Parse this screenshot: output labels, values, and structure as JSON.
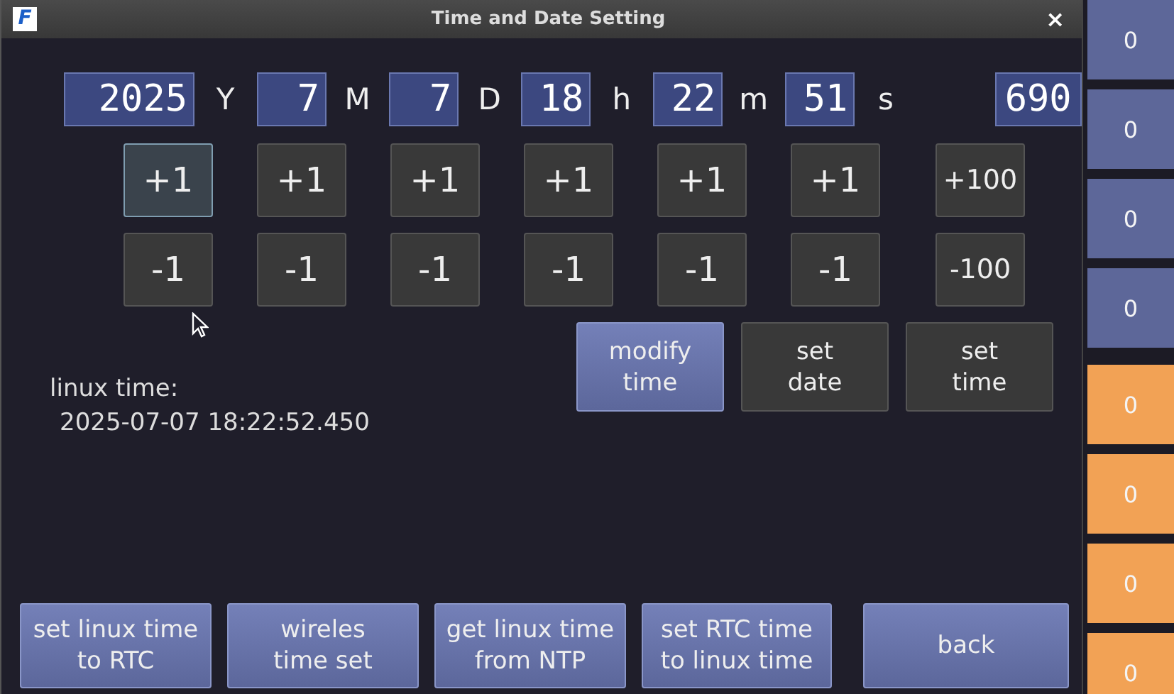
{
  "window": {
    "title": "Time and Date Setting",
    "logo_letter": "F",
    "close": "×"
  },
  "fields": [
    {
      "value": "2025",
      "unit": "Y"
    },
    {
      "value": "7",
      "unit": "M"
    },
    {
      "value": "7",
      "unit": "D"
    },
    {
      "value": "18",
      "unit": "h"
    },
    {
      "value": "22",
      "unit": "m"
    },
    {
      "value": "51",
      "unit": "s"
    },
    {
      "value": "690"
    }
  ],
  "increment_buttons": [
    {
      "label": "+1",
      "focused": true
    },
    {
      "label": "+1",
      "focused": false
    },
    {
      "label": "+1",
      "focused": false
    },
    {
      "label": "+1",
      "focused": false
    },
    {
      "label": "+1",
      "focused": false
    },
    {
      "label": "+1",
      "focused": false
    },
    {
      "label": "+100",
      "focused": false
    }
  ],
  "decrement_buttons": [
    {
      "label": "-1"
    },
    {
      "label": "-1"
    },
    {
      "label": "-1"
    },
    {
      "label": "-1"
    },
    {
      "label": "-1"
    },
    {
      "label": "-1"
    },
    {
      "label": "-100"
    }
  ],
  "action_buttons": [
    {
      "label": "modify time",
      "kind": "primary"
    },
    {
      "label": "set date",
      "kind": "secondary"
    },
    {
      "label": "set time",
      "kind": "secondary"
    }
  ],
  "linux_time": {
    "label": "linux time:",
    "value": "2025-07-07 18:22:52.450"
  },
  "bottom_buttons": [
    {
      "label": "set linux time to RTC"
    },
    {
      "label": "wireles time set"
    },
    {
      "label": "get linux time from NTP"
    },
    {
      "label": "set RTC time to linux time"
    },
    {
      "label": "back"
    }
  ],
  "side_tiles": [
    {
      "label": "0",
      "color": "#5d6799"
    },
    {
      "label": "0",
      "color": "#5d6799"
    },
    {
      "label": "0",
      "color": "#5d6799"
    },
    {
      "label": "0",
      "color": "#5d6799"
    },
    {
      "label": "0",
      "color": "#f2a255"
    },
    {
      "label": "0",
      "color": "#f2a255"
    },
    {
      "label": "0",
      "color": "#f2a255"
    },
    {
      "label": "0",
      "color": "#f2a255"
    }
  ]
}
